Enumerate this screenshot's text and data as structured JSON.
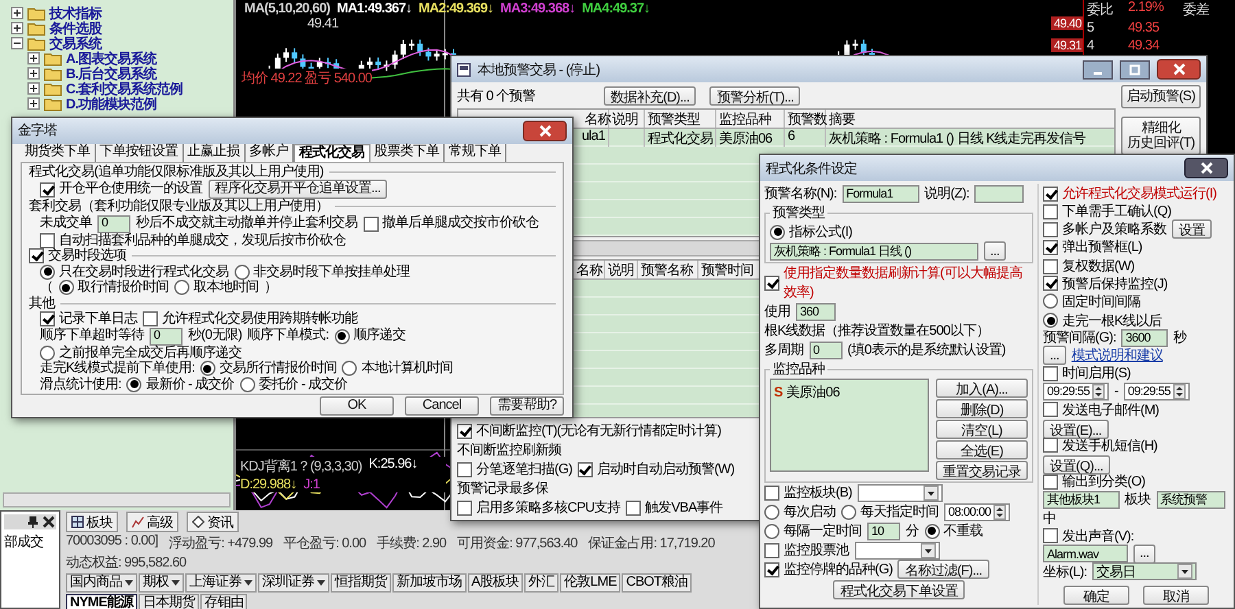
{
  "tree": [
    {
      "label": "技术指标",
      "expanded": false
    },
    {
      "label": "条件选股",
      "expanded": false
    },
    {
      "label": "交易系统",
      "expanded": true,
      "children": [
        {
          "label": "A.图表交易系统",
          "expanded": false
        },
        {
          "label": "B.后台交易系统",
          "expanded": false
        },
        {
          "label": "C.套利交易系统范例",
          "expanded": false
        },
        {
          "label": "D.功能模块范例",
          "expanded": false
        }
      ]
    }
  ],
  "chart": {
    "ma_legend": [
      {
        "text": "MA(5,10,20,60)",
        "color": "#d0d0d0"
      },
      {
        "text": "MA1:49.367↓",
        "color": "#ffffff"
      },
      {
        "text": "MA2:49.369↓",
        "color": "#e8e060"
      },
      {
        "text": "MA3:49.368↓",
        "color": "#d040d0"
      },
      {
        "text": "MA4:49.37↓",
        "color": "#40d040"
      }
    ],
    "peak_label": "49.41",
    "info": "均价 49.22 盈亏 540.00",
    "price_tags": [
      "49.40",
      "49.31"
    ],
    "kdj_legend": [
      {
        "text": "KDJ背离1？(9,3,3,30)",
        "color": "#d0d0d0"
      },
      {
        "text": "K:25.96↓",
        "color": "#ffffff"
      },
      {
        "text": "D:29.988↓",
        "color": "#e8e060"
      },
      {
        "text": "J:1",
        "color": "#d040d0"
      }
    ]
  },
  "quote": {
    "header": [
      "委比",
      "2.19%",
      "委差"
    ],
    "rows": [
      {
        "rank": "5",
        "price": "49.35"
      },
      {
        "rank": "4",
        "price": "49.34"
      }
    ]
  },
  "side_panel": {
    "label": "部成交"
  },
  "toolbar": [
    "板块",
    "高级",
    "资讯"
  ],
  "status": [
    "70003095 : 0.00]",
    "浮动盈亏: +479.99",
    "平仓盈亏: 0.00",
    "手续费: 2.90",
    "可用资金: 977,563.40",
    "保证金占用: 17,719.20",
    "动态权益: 995,582.60"
  ],
  "market_tabs": [
    {
      "label": "国内商品",
      "dropdown": true,
      "selected": false
    },
    {
      "label": "期权",
      "dropdown": true,
      "selected": false
    },
    {
      "label": "上海证券",
      "dropdown": true,
      "selected": false
    },
    {
      "label": "深圳证券",
      "dropdown": true,
      "selected": false
    },
    {
      "label": "恒指期货",
      "dropdown": false,
      "selected": false
    },
    {
      "label": "新加坡市场",
      "dropdown": false,
      "selected": false
    },
    {
      "label": "A股板块",
      "dropdown": false,
      "selected": false
    },
    {
      "label": "外汇",
      "dropdown": false,
      "selected": false
    },
    {
      "label": "伦敦LME",
      "dropdown": false,
      "selected": false
    },
    {
      "label": "CBOT粮油",
      "dropdown": false,
      "selected": false
    },
    {
      "label": "NYME能源",
      "dropdown": false,
      "selected": true
    },
    {
      "label": "日本期货",
      "dropdown": false,
      "selected": false
    },
    {
      "label": "存钼由",
      "dropdown": false,
      "selected": false
    }
  ],
  "alert_window": {
    "title": "本地预警交易 - (停止)",
    "count": "共有 0 个预警",
    "toolbar": [
      "数据补充(D)...",
      "预警分析(T)..."
    ],
    "side_buttons": [
      [
        "启动预警(S)"
      ],
      [
        "精细化",
        "历史回评(T)"
      ]
    ],
    "table": {
      "columns": [
        "名称",
        "说明",
        "预警类型",
        "监控品种",
        "预警数",
        "摘要"
      ],
      "rows": [
        {
          "name": "ula1",
          "type": "程式化交易",
          "symbol": "美原油06",
          "count": "6",
          "summary": "灰机策略 : Formula1 () 日线 K线走完再发信号"
        }
      ]
    },
    "log_table": {
      "columns": [
        "名称",
        "说明",
        "预警名称",
        "预警时间"
      ]
    },
    "options": [
      {
        "items": [
          {
            "kind": "check",
            "label": "不间断监控(T)(无论有无新行情都定时计算)",
            "checked": true
          },
          {
            "kind": "label",
            "text": "不间断监控刷新频"
          }
        ]
      },
      {
        "items": [
          {
            "kind": "check",
            "label": "分笔逐笔扫描(G)",
            "checked": false
          },
          {
            "kind": "check",
            "label": "启动时自动启动预警(W)",
            "checked": true
          },
          {
            "kind": "label",
            "text": "预警记录最多保"
          }
        ]
      },
      {
        "items": [
          {
            "kind": "check",
            "label": "启用多策略多核CPU支持",
            "checked": false
          },
          {
            "kind": "check",
            "label": "触发VBA事件",
            "checked": false
          }
        ]
      }
    ]
  },
  "pyramid_dialog": {
    "title": "金字塔",
    "tabs": [
      {
        "label": "期货类下单",
        "selected": false
      },
      {
        "label": "下单按钮设置",
        "selected": false
      },
      {
        "label": "止赢止损",
        "selected": false
      },
      {
        "label": "多帐户",
        "selected": false
      },
      {
        "label": "程式化交易",
        "selected": true
      },
      {
        "label": "股票类下单",
        "selected": false
      },
      {
        "label": "常规下单",
        "selected": false
      }
    ],
    "sections": [
      {
        "title": {
          "kind": "label",
          "text": "程式化交易(追单功能仅限标准版及其以上用户使用)"
        },
        "rows": [
          {
            "items": [
              {
                "kind": "check",
                "label": "开仓平仓使用统一的设置",
                "checked": true
              },
              {
                "kind": "button",
                "label": "程序化交易开平仓追单设置..."
              }
            ]
          }
        ]
      },
      {
        "title": {
          "kind": "label",
          "text": "套利交易（套利功能仅限专业版及其以上用户使用）"
        },
        "rows": [
          {
            "items": [
              {
                "kind": "label",
                "text": "未成交单"
              },
              {
                "kind": "field",
                "value": "0"
              },
              {
                "kind": "label",
                "text": "秒后不成交就主动撤单并停止套利交易"
              },
              {
                "kind": "check",
                "label": "撤单后单腿成交按市价砍仓",
                "checked": false
              }
            ]
          },
          {
            "items": [
              {
                "kind": "check",
                "label": "自动扫描套利品种的单腿成交，发现后按市价砍仓",
                "checked": false
              }
            ]
          }
        ]
      },
      {
        "title": {
          "kind": "check",
          "label": "交易时段选项",
          "checked": true
        },
        "rows": [
          {
            "items": [
              {
                "kind": "radio",
                "label": "只在交易时段进行程式化交易",
                "selected": true
              },
              {
                "kind": "radio",
                "label": "非交易时段下单按挂单处理",
                "selected": false
              }
            ]
          },
          {
            "items": [
              {
                "kind": "label",
                "text": "（"
              },
              {
                "kind": "radio",
                "label": "取行情报价时间",
                "selected": true
              },
              {
                "kind": "radio",
                "label": "取本地时间",
                "selected": false
              },
              {
                "kind": "label",
                "text": "）"
              }
            ]
          }
        ]
      },
      {
        "title": {
          "kind": "label",
          "text": "其他"
        },
        "rows": [
          {
            "items": [
              {
                "kind": "check",
                "label": "记录下单日志",
                "checked": true
              },
              {
                "kind": "check",
                "label": "允许程式化交易使用跨期转帐功能",
                "checked": false
              }
            ]
          },
          {
            "items": [
              {
                "kind": "label",
                "text": "顺序下单超时等待"
              },
              {
                "kind": "field",
                "value": "0"
              },
              {
                "kind": "label",
                "text": "秒(0无限)"
              },
              {
                "kind": "label",
                "text": "顺序下单模式:"
              },
              {
                "kind": "radio",
                "label": "顺序递交",
                "selected": true
              },
              {
                "kind": "radio",
                "label": "之前报单完全成交后再顺序递交",
                "selected": false
              }
            ]
          },
          {
            "items": [
              {
                "kind": "label",
                "text": "走完K线模式提前下单使用:"
              },
              {
                "kind": "radio",
                "label": "交易所行情报价时间",
                "selected": true
              },
              {
                "kind": "radio",
                "label": "本地计算机时间",
                "selected": false
              }
            ]
          },
          {
            "items": [
              {
                "kind": "label",
                "text": "滑点统计使用:"
              },
              {
                "kind": "radio",
                "label": "最新价 - 成交价",
                "selected": true
              },
              {
                "kind": "radio",
                "label": "委托价 - 成交价",
                "selected": false
              }
            ]
          }
        ]
      }
    ],
    "buttons": [
      "OK",
      "Cancel",
      "需要帮助?"
    ]
  },
  "condition_dialog": {
    "title": "程式化条件设定",
    "left": [
      {
        "kind": "row",
        "items": [
          {
            "kind": "label",
            "text": "预警名称(N):"
          },
          {
            "kind": "field",
            "value": "Formula1"
          },
          {
            "kind": "label",
            "text": "说明(Z):"
          },
          {
            "kind": "field"
          }
        ]
      },
      {
        "kind": "group",
        "title": "预警类型",
        "rows": [
          {
            "items": [
              {
                "kind": "radio",
                "label": "指标公式(I)",
                "selected": true
              },
              {
                "kind": "field",
                "value": "灰机策略 : Formula1 日线 ()"
              },
              {
                "kind": "button",
                "label": "..."
              }
            ]
          }
        ]
      },
      {
        "kind": "row",
        "items": [
          {
            "kind": "check",
            "label": "使用指定数量数据刷新计算(可以大幅提高效率)",
            "checked": true,
            "highlight": true
          }
        ]
      },
      {
        "kind": "row",
        "items": [
          {
            "kind": "label",
            "text": "使用"
          },
          {
            "kind": "field",
            "value": "360"
          },
          {
            "kind": "label",
            "text": "根K线数据（推荐设置数量在500以下）"
          }
        ]
      },
      {
        "kind": "row",
        "items": [
          {
            "kind": "label",
            "text": "多周期"
          },
          {
            "kind": "field",
            "value": "0"
          },
          {
            "kind": "label",
            "text": "(填0表示的是系统默认设置)"
          }
        ]
      },
      {
        "kind": "list",
        "title": "监控品种",
        "entries": [
          {
            "badge": "S",
            "label": "美原油06"
          }
        ],
        "buttons": [
          "加入(A)...",
          "删除(D)",
          "清空(L)",
          "全选(E)",
          "重置交易记录"
        ]
      },
      {
        "kind": "row",
        "items": [
          {
            "kind": "check",
            "label": "监控板块(B)",
            "checked": false
          },
          {
            "kind": "combo"
          }
        ]
      },
      {
        "kind": "row",
        "items": [
          {
            "kind": "radio",
            "label": "每次启动",
            "selected": false
          },
          {
            "kind": "radio",
            "label": "每天指定时间",
            "selected": false
          },
          {
            "kind": "spin",
            "value": "08:00:00"
          }
        ]
      },
      {
        "kind": "row",
        "items": [
          {
            "kind": "radio",
            "label": "每隔一定时间",
            "selected": false
          },
          {
            "kind": "field",
            "value": "10"
          },
          {
            "kind": "label",
            "text": "分"
          },
          {
            "kind": "radio",
            "label": "不重载",
            "selected": true
          }
        ]
      },
      {
        "kind": "row",
        "items": [
          {
            "kind": "check",
            "label": "监控股票池",
            "checked": false
          },
          {
            "kind": "combo"
          }
        ]
      },
      {
        "kind": "row",
        "items": [
          {
            "kind": "check",
            "label": "监控停牌的品种(G)",
            "checked": true
          },
          {
            "kind": "button",
            "label": "名称过滤(F)..."
          }
        ]
      }
    ],
    "right": [
      {
        "kind": "row",
        "items": [
          {
            "kind": "check",
            "label": "允许程式化交易模式运行(I)",
            "checked": true,
            "highlight": true
          }
        ]
      },
      {
        "kind": "row",
        "items": [
          {
            "kind": "check",
            "label": "下单需手工确认(Q)",
            "checked": false
          }
        ]
      },
      {
        "kind": "row",
        "items": [
          {
            "kind": "check",
            "label": "多帐户及策略系数",
            "checked": false
          },
          {
            "kind": "button",
            "label": "设置"
          }
        ]
      },
      {
        "kind": "row",
        "items": [
          {
            "kind": "check",
            "label": "弹出预警框(L)",
            "checked": true
          },
          {
            "kind": "check",
            "label": "复权数据(W)",
            "checked": false
          }
        ]
      },
      {
        "kind": "row",
        "items": [
          {
            "kind": "check",
            "label": "预警后保持监控(J)",
            "checked": true
          }
        ]
      },
      {
        "kind": "row",
        "items": [
          {
            "kind": "radio",
            "label": "固定时间间隔",
            "selected": false
          },
          {
            "kind": "radio",
            "label": "走完一根K线以后",
            "selected": true
          }
        ]
      },
      {
        "kind": "row",
        "items": [
          {
            "kind": "label",
            "text": "预警间隔(G):"
          },
          {
            "kind": "field",
            "value": "3600"
          },
          {
            "kind": "label",
            "text": "秒"
          }
        ]
      },
      {
        "kind": "row",
        "items": [
          {
            "kind": "button",
            "label": "..."
          },
          {
            "kind": "link",
            "text": "模式说明和建议"
          }
        ]
      },
      {
        "kind": "row",
        "items": [
          {
            "kind": "check",
            "label": "时间启用(S)",
            "checked": false
          }
        ]
      },
      {
        "kind": "row",
        "items": [
          {
            "kind": "spin",
            "value": "09:29:55"
          },
          {
            "kind": "label",
            "text": "-"
          },
          {
            "kind": "spin",
            "value": "09:29:55"
          }
        ]
      },
      {
        "kind": "row",
        "items": [
          {
            "kind": "check",
            "label": "发送电子邮件(M)",
            "checked": false
          },
          {
            "kind": "button",
            "label": "设置(E)..."
          }
        ]
      },
      {
        "kind": "row",
        "items": [
          {
            "kind": "check",
            "label": "发送手机短信(H)",
            "checked": false
          },
          {
            "kind": "button",
            "label": "设置(Q)..."
          }
        ]
      },
      {
        "kind": "row",
        "items": [
          {
            "kind": "check",
            "label": "输出到分类(O)",
            "checked": false
          }
        ]
      },
      {
        "kind": "row",
        "items": [
          {
            "kind": "field",
            "value": "其他板块1"
          },
          {
            "kind": "label",
            "text": "板块"
          },
          {
            "kind": "field",
            "value": "系统预警"
          },
          {
            "kind": "label",
            "text": "中"
          }
        ]
      },
      {
        "kind": "row",
        "items": [
          {
            "kind": "check",
            "label": "发出声音(V):",
            "checked": false
          }
        ]
      },
      {
        "kind": "row",
        "items": [
          {
            "kind": "field",
            "value": "Alarm.wav"
          },
          {
            "kind": "button",
            "label": "..."
          }
        ]
      },
      {
        "kind": "row",
        "items": [
          {
            "kind": "label",
            "text": "坐标(L):"
          },
          {
            "kind": "combo",
            "value": "交易日"
          }
        ]
      }
    ],
    "buttons": [
      "确定",
      "取消"
    ],
    "footer_button": "程式化交易下单设置"
  }
}
